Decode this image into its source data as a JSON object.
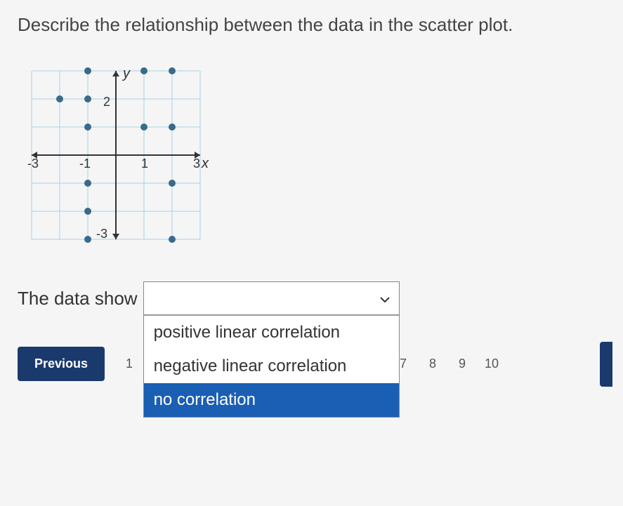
{
  "question": "Describe the relationship between the data in the scatter plot.",
  "chart_data": {
    "type": "scatter",
    "xlabel": "x",
    "ylabel": "y",
    "xlim": [
      -3.5,
      3.5
    ],
    "ylim": [
      -3.5,
      3.5
    ],
    "x_ticks": [
      -3,
      -1,
      1,
      3
    ],
    "y_ticks": [
      -3,
      2
    ],
    "points": [
      [
        -2,
        2
      ],
      [
        -1,
        2
      ],
      [
        -1,
        3
      ],
      [
        -1,
        1
      ],
      [
        -1,
        -1
      ],
      [
        -1,
        -2
      ],
      [
        -1,
        -3
      ],
      [
        1,
        3
      ],
      [
        1,
        1
      ],
      [
        2,
        3
      ],
      [
        2,
        1
      ],
      [
        2,
        -1
      ],
      [
        2,
        -3
      ]
    ]
  },
  "answer": {
    "prefix": "The data show",
    "selected": "",
    "options": [
      "positive linear correlation",
      "negative linear correlation",
      "no correlation"
    ],
    "highlighted_index": 2
  },
  "nav": {
    "previous": "Previous",
    "first_page": "1",
    "pages": [
      "7",
      "8",
      "9",
      "10"
    ]
  }
}
